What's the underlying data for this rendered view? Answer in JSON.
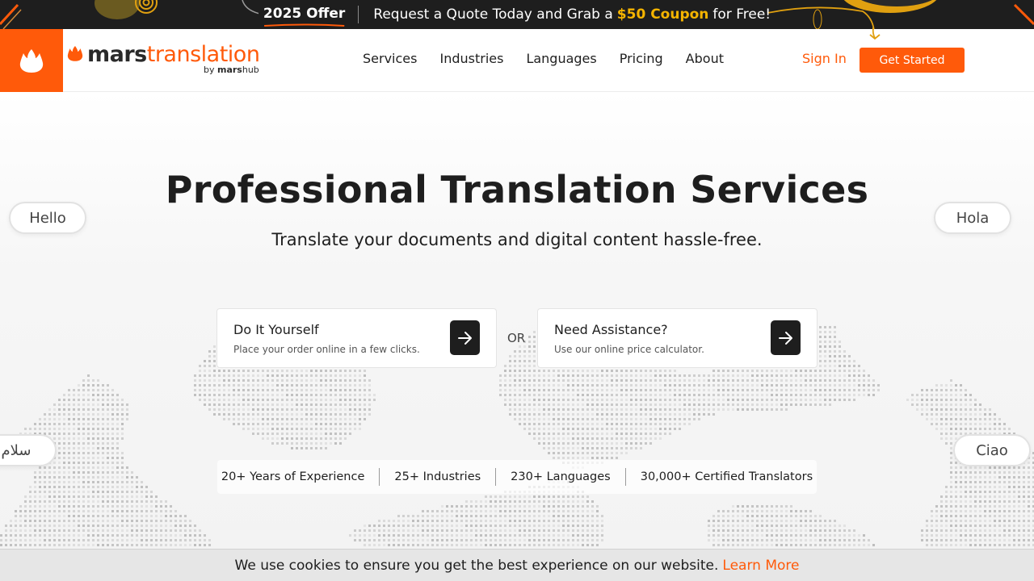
{
  "promo": {
    "offer": "2025 Offer",
    "text_before": "Request a Quote Today and Grab a",
    "coupon": "$50 Coupon",
    "text_after": "for Free!"
  },
  "brand": {
    "name_part1": "mars",
    "name_part2": "translation",
    "by_label": "by",
    "by_part1": "mars",
    "by_part2": "hub"
  },
  "nav": {
    "items": [
      "Services",
      "Industries",
      "Languages",
      "Pricing",
      "About"
    ],
    "signin": "Sign In",
    "cta": "Get Started"
  },
  "hero": {
    "title": "Professional Translation Services",
    "subtitle": "Translate your documents and digital content hassle-free.",
    "bubbles": [
      "Hello",
      "Hola",
      "سلام",
      "Ciao"
    ],
    "cards": [
      {
        "title": "Do It Yourself",
        "desc": "Place your order online in a few clicks."
      },
      {
        "title": "Need Assistance?",
        "desc": "Use our online price calculator."
      }
    ],
    "or_label": "OR",
    "stats": [
      "20+ Years of Experience",
      "25+ Industries",
      "230+ Languages",
      "30,000+ Certified Translators"
    ]
  },
  "cookie": {
    "text": "We use cookies to ensure you get the best experience on our website.",
    "link": "Learn More"
  },
  "colors": {
    "brand_orange": "#ff5a0a",
    "coupon_yellow": "#f5b400",
    "dark": "#1e1e1e"
  }
}
